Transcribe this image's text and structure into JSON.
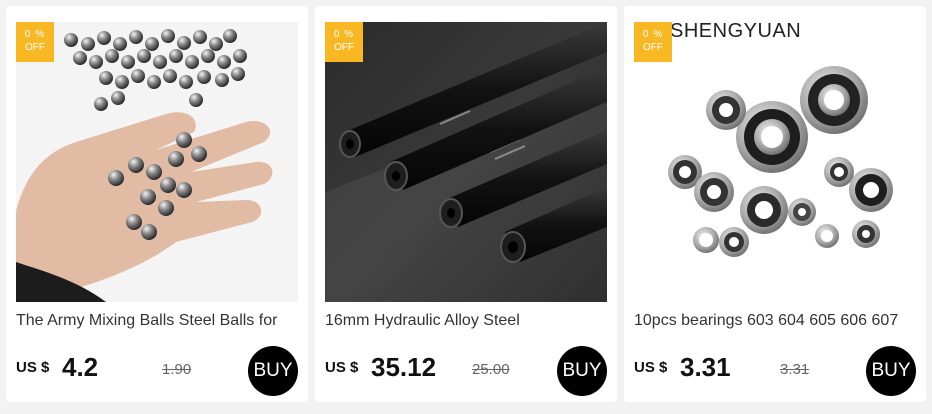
{
  "products": [
    {
      "badge_top": "0 %",
      "badge_bottom": "OFF",
      "title": "The Army Mixing Balls Steel Balls for",
      "currency": "US $",
      "price": "4.2",
      "old_price": "1.90",
      "buy_label": "BUY"
    },
    {
      "badge_top": "0 %",
      "badge_bottom": "OFF",
      "title": "16mm Hydraulic Alloy Steel",
      "currency": "US $",
      "price": "35.12",
      "old_price": "25.00",
      "buy_label": "BUY"
    },
    {
      "badge_top": "0 %",
      "badge_bottom": "OFF",
      "brand": "SHENGYUAN",
      "title": "10pcs bearings 603 604 605 606 607",
      "currency": "US $",
      "price": "3.31",
      "old_price": "3.31",
      "buy_label": "BUY"
    }
  ],
  "colors": {
    "badge": "#f8b824",
    "buy_button": "#000000",
    "background": "#f2f2f2"
  }
}
